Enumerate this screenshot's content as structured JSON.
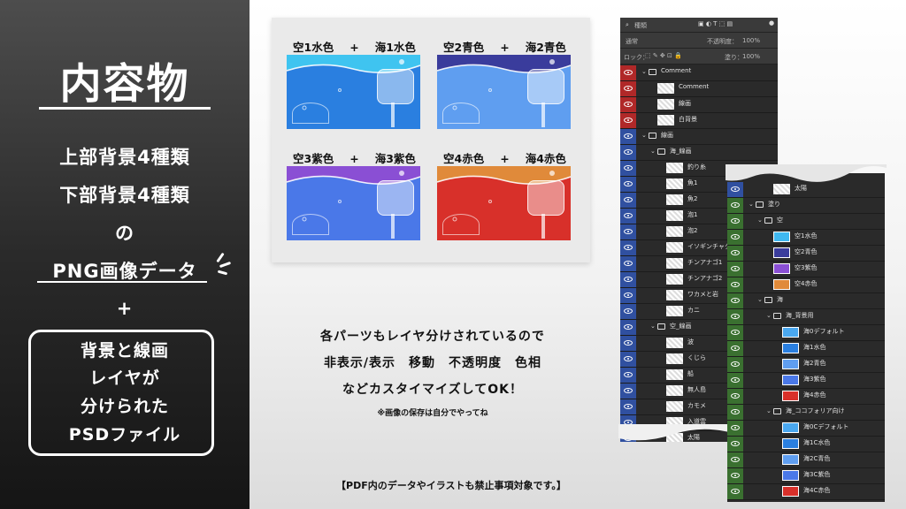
{
  "left": {
    "title": "内容物",
    "line1": "上部背景4種類",
    "line2": "下部背景4種類",
    "line3": "の",
    "line4": "PNG画像データ",
    "plus": "+",
    "psd1": "背景と線画",
    "psd2": "レイヤが",
    "psd3": "分けられた",
    "psd4": "PSDファイル"
  },
  "previews": [
    {
      "caption_sky": "空1水色",
      "plus": "+",
      "caption_sea": "海1水色",
      "sky_color": "#3fc4f0",
      "sea_color": "#2a7fe0"
    },
    {
      "caption_sky": "空2青色",
      "plus": "+",
      "caption_sea": "海2青色",
      "sky_color": "#3a3c9c",
      "sea_color": "#5f9ef0"
    },
    {
      "caption_sky": "空3紫色",
      "plus": "+",
      "caption_sea": "海3紫色",
      "sky_color": "#8a4fd4",
      "sea_color": "#4a78e8"
    },
    {
      "caption_sky": "空4赤色",
      "plus": "+",
      "caption_sea": "海4赤色",
      "sky_color": "#e08a3a",
      "sea_color": "#d8302a"
    }
  ],
  "middle": {
    "line1": "各パーツもレイヤ分けされているので",
    "line2": "非表示/表示　移動　不透明度　色相",
    "line3": "などカスタイマイズしてOK！",
    "note": "※画像の保存は自分でやってね"
  },
  "footer": "【PDF内のデータやイラストも禁止事項対象です。】",
  "layers_panel_1": {
    "kind_label": "種類",
    "blend_mode": "通常",
    "opacity_label": "不透明度：",
    "opacity_value": "100%",
    "lock_label": "ロック：",
    "fill_label": "塗り：",
    "fill_value": "100%",
    "rows": [
      {
        "type": "folder",
        "label": "Comment",
        "indent": 1,
        "eye": "#b02828"
      },
      {
        "type": "layer",
        "label": "Comment",
        "indent": 2,
        "eye": "#b02828"
      },
      {
        "type": "layer",
        "label": "線画",
        "indent": 2,
        "eye": "#b02828"
      },
      {
        "type": "layer",
        "label": "白背景",
        "indent": 2,
        "eye": "#b02828"
      },
      {
        "type": "folder",
        "label": "線画",
        "indent": 1,
        "eye": "#3050a0"
      },
      {
        "type": "folder",
        "label": "海_線画",
        "indent": 2,
        "eye": "#3050a0"
      },
      {
        "type": "layer",
        "label": "釣り糸",
        "indent": 3,
        "eye": "#3050a0"
      },
      {
        "type": "layer",
        "label": "魚1",
        "indent": 3,
        "eye": "#3050a0"
      },
      {
        "type": "layer",
        "label": "魚2",
        "indent": 3,
        "eye": "#3050a0"
      },
      {
        "type": "layer",
        "label": "泡1",
        "indent": 3,
        "eye": "#3050a0"
      },
      {
        "type": "layer",
        "label": "泡2",
        "indent": 3,
        "eye": "#3050a0"
      },
      {
        "type": "layer",
        "label": "イソギンチャク",
        "indent": 3,
        "eye": "#3050a0"
      },
      {
        "type": "layer",
        "label": "チンアナゴ1",
        "indent": 3,
        "eye": "#3050a0"
      },
      {
        "type": "layer",
        "label": "チンアナゴ2",
        "indent": 3,
        "eye": "#3050a0"
      },
      {
        "type": "layer",
        "label": "ワカメと岩",
        "indent": 3,
        "eye": "#3050a0"
      },
      {
        "type": "layer",
        "label": "カニ",
        "indent": 3,
        "eye": "#3050a0"
      },
      {
        "type": "folder",
        "label": "空_線画",
        "indent": 2,
        "eye": "#3050a0"
      },
      {
        "type": "layer",
        "label": "波",
        "indent": 3,
        "eye": "#3050a0"
      },
      {
        "type": "layer",
        "label": "くじら",
        "indent": 3,
        "eye": "#3050a0"
      },
      {
        "type": "layer",
        "label": "船",
        "indent": 3,
        "eye": "#3050a0"
      },
      {
        "type": "layer",
        "label": "無人島",
        "indent": 3,
        "eye": "#3050a0"
      },
      {
        "type": "layer",
        "label": "カモメ",
        "indent": 3,
        "eye": "#3050a0"
      },
      {
        "type": "layer",
        "label": "入道雲",
        "indent": 3,
        "eye": "#3050a0"
      },
      {
        "type": "layer",
        "label": "太陽",
        "indent": 3,
        "eye": "#3050a0"
      },
      {
        "type": "folder",
        "label": "塗り",
        "indent": 1,
        "eye": "#3a7030"
      }
    ]
  },
  "layers_panel_2": {
    "rows": [
      {
        "type": "layer",
        "label": "太陽",
        "indent": 3,
        "eye": "#3050a0"
      },
      {
        "type": "folder",
        "label": "塗り",
        "indent": 1,
        "eye": "#3a7030"
      },
      {
        "type": "folder",
        "label": "空",
        "indent": 2,
        "eye": "#3a7030"
      },
      {
        "type": "layer",
        "label": "空1水色",
        "indent": 3,
        "eye": "#3a7030",
        "swatch": "#3fb8f0"
      },
      {
        "type": "layer",
        "label": "空2青色",
        "indent": 3,
        "eye": "#3a7030",
        "swatch": "#3a3c9c"
      },
      {
        "type": "layer",
        "label": "空3紫色",
        "indent": 3,
        "eye": "#3a7030",
        "swatch": "#8a4fd4"
      },
      {
        "type": "layer",
        "label": "空4赤色",
        "indent": 3,
        "eye": "#3a7030",
        "swatch": "#e08a3a"
      },
      {
        "type": "folder",
        "label": "海",
        "indent": 2,
        "eye": "#3a7030"
      },
      {
        "type": "folder",
        "label": "海_背景用",
        "indent": 3,
        "eye": "#3a7030"
      },
      {
        "type": "layer",
        "label": "海0デフォルト",
        "indent": 4,
        "eye": "#3a7030",
        "swatch": "#4aa8f0"
      },
      {
        "type": "layer",
        "label": "海1水色",
        "indent": 4,
        "eye": "#3a7030",
        "swatch": "#2a7fe0"
      },
      {
        "type": "layer",
        "label": "海2青色",
        "indent": 4,
        "eye": "#3a7030",
        "swatch": "#5f9ef0"
      },
      {
        "type": "layer",
        "label": "海3紫色",
        "indent": 4,
        "eye": "#3a7030",
        "swatch": "#4a78e8"
      },
      {
        "type": "layer",
        "label": "海4赤色",
        "indent": 4,
        "eye": "#3a7030",
        "swatch": "#d8302a"
      },
      {
        "type": "folder",
        "label": "海_ココフォリア向け",
        "indent": 3,
        "eye": "#3a7030"
      },
      {
        "type": "layer",
        "label": "海0Cデフォルト",
        "indent": 4,
        "eye": "#3a7030",
        "swatch": "#4aa8f0"
      },
      {
        "type": "layer",
        "label": "海1C水色",
        "indent": 4,
        "eye": "#3a7030",
        "swatch": "#2a7fe0"
      },
      {
        "type": "layer",
        "label": "海2C青色",
        "indent": 4,
        "eye": "#3a7030",
        "swatch": "#5f9ef0"
      },
      {
        "type": "layer",
        "label": "海3C紫色",
        "indent": 4,
        "eye": "#3a7030",
        "swatch": "#4a78e8"
      },
      {
        "type": "layer",
        "label": "海4C赤色",
        "indent": 4,
        "eye": "#3a7030",
        "swatch": "#d8302a"
      }
    ]
  }
}
